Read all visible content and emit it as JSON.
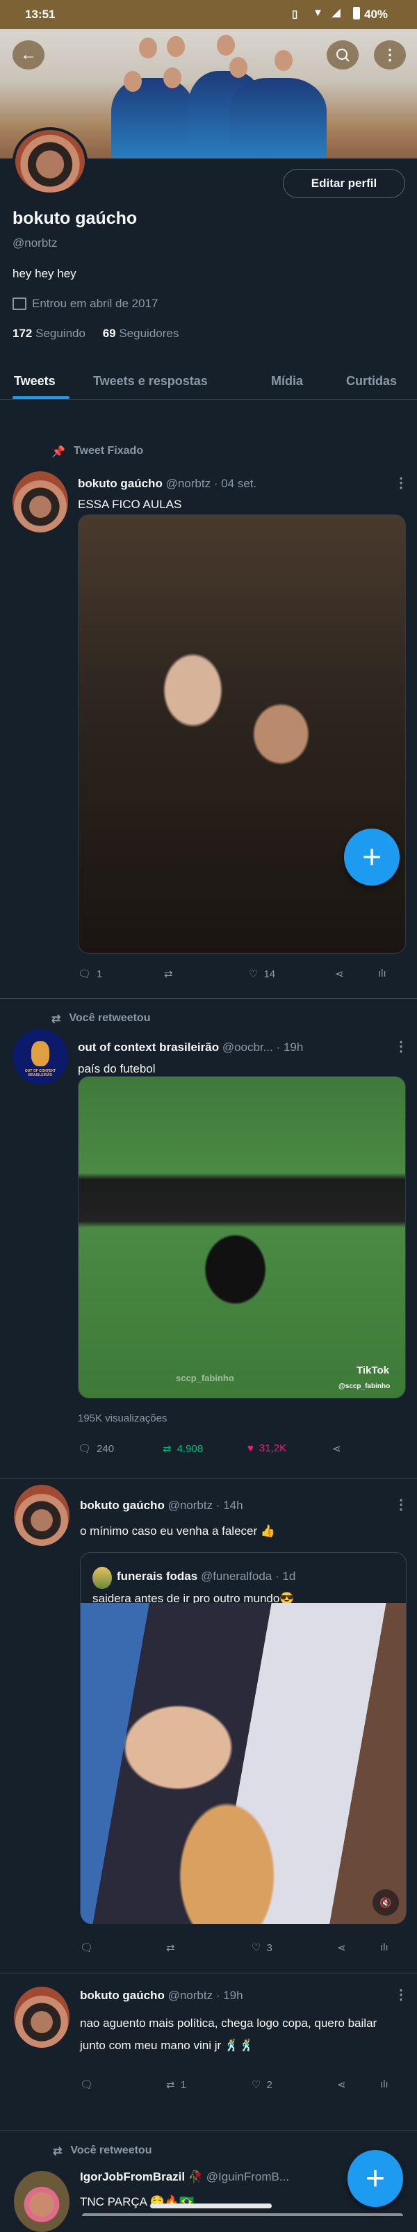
{
  "status_bar": {
    "time": "13:51",
    "battery": "40%"
  },
  "profile": {
    "edit_button": "Editar perfil",
    "name": "bokuto gaúcho",
    "handle": "@norbtz",
    "bio": "hey hey hey",
    "joined": "Entrou em abril de 2017",
    "following_count": "172",
    "following_label": "Seguindo",
    "followers_count": "69",
    "followers_label": "Seguidores"
  },
  "tabs": [
    {
      "label": "Tweets"
    },
    {
      "label": "Tweets e respostas"
    },
    {
      "label": "Mídia"
    },
    {
      "label": "Curtidas"
    }
  ],
  "tweets": [
    {
      "context": "Tweet Fixado",
      "name": "bokuto gaúcho",
      "handle": "@norbtz",
      "time": "· 04 set.",
      "text": "ESSA FICO AULAS",
      "replies": "1",
      "retweets": "",
      "likes": "14"
    },
    {
      "context": "Você retweetou",
      "name": "out of context brasileirão",
      "handle": "@oocbr...",
      "time": "· 19h",
      "text": "país do futebol",
      "avatar_text": "OUT OF CONTEXT BRASILEIRÃO",
      "watermark": "sccp_fabinho",
      "tiktok": "TikTok",
      "tiktok_handle": "@sccp_fabinho",
      "views": "195K visualizações",
      "replies": "240",
      "retweets": "4.908",
      "likes": "31,2K",
      "retweet_color": "#00ba7c",
      "like_color": "#f91880"
    },
    {
      "name": "bokuto gaúcho",
      "handle": "@norbtz",
      "time": "· 14h",
      "text": "o mínimo caso eu venha a falecer 👍",
      "quote": {
        "name": "funerais fodas",
        "handle": "@funeralfoda",
        "time": "· 1d",
        "text": "saidera antes de ir pro outro mundo😎"
      },
      "replies": "",
      "retweets": "",
      "likes": "3"
    },
    {
      "name": "bokuto gaúcho",
      "handle": "@norbtz",
      "time": "· 19h",
      "text": "nao aguento mais política, chega logo copa, quero bailar junto com meu mano vini jr 🕺🕺",
      "replies": "",
      "retweets": "1",
      "likes": "2"
    },
    {
      "context": "Você retweetou",
      "name": "IgorJobFromBrazil 🥀",
      "handle": "@IguinFromB...",
      "text": "TNC PARÇA 🤤🔥🇧🇷"
    }
  ],
  "fab": {
    "label": "+"
  }
}
